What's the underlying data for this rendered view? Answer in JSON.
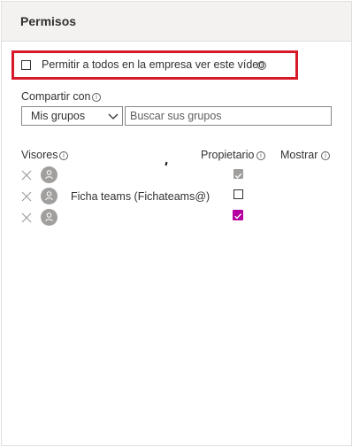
{
  "panel": {
    "title": "Permisos"
  },
  "company_permission": {
    "label": "Permitir a todos en la empresa ver este vídeo",
    "checked": false,
    "info_icon": "info-icon"
  },
  "share": {
    "label": "Compartir con",
    "group_select_value": "Mis grupos",
    "search_placeholder": "Buscar sus grupos"
  },
  "viewers": {
    "column_viewers": "Visores",
    "column_owner": "Propietario",
    "column_show": "Mostrar",
    "rows": [
      {
        "name": "",
        "owner_state": "checked-disabled"
      },
      {
        "name": "Ficha teams (Fichateams@)",
        "owner_state": "unchecked"
      },
      {
        "name": "",
        "owner_state": "checked"
      }
    ]
  },
  "colors": {
    "highlight_border": "#d7192a",
    "checked_accent": "#b4009e",
    "header_background": "#f3f2f1"
  }
}
